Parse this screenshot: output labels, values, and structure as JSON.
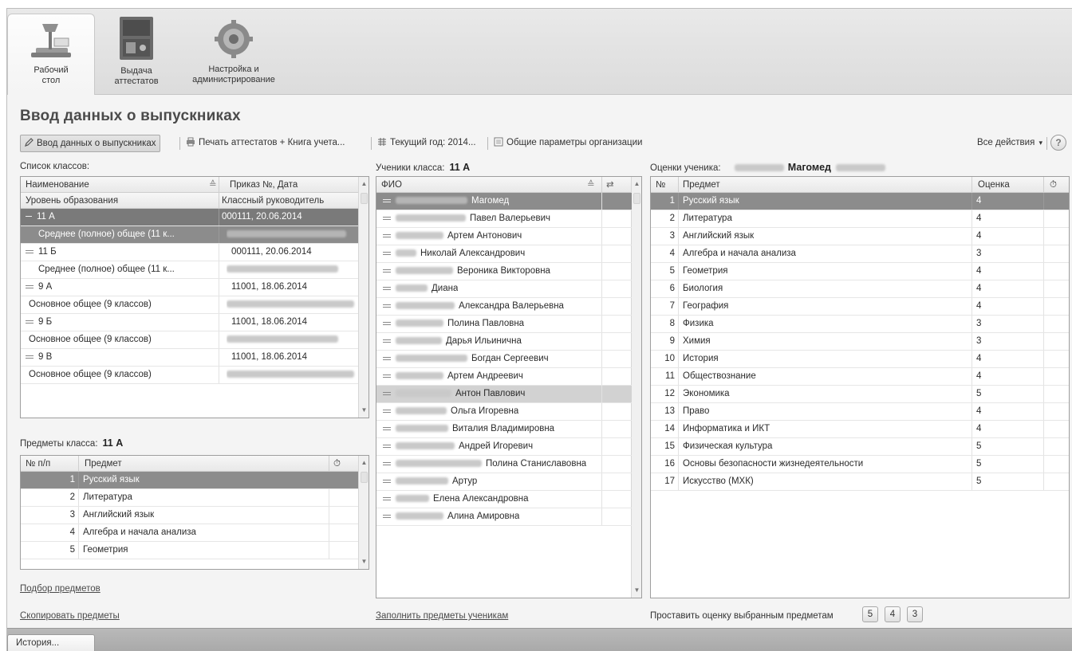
{
  "sections": [
    {
      "label1": "Рабочий",
      "label2": "стол",
      "icon": "desk-lamp-icon"
    },
    {
      "label1": "Выдача",
      "label2": "аттестатов",
      "icon": "safe-icon"
    },
    {
      "label1": "Настройка и",
      "label2": "администрирование",
      "icon": "gear-icon"
    }
  ],
  "title": "Ввод данных о выпускниках",
  "toolbar": {
    "input_data": "Ввод данных о выпускниках",
    "print": "Печать аттестатов + Книга учета...",
    "current_year": "Текущий год: 2014...",
    "org_params": "Общие параметры организации",
    "all_actions": "Все действия",
    "help": "?"
  },
  "classes": {
    "label": "Список классов:",
    "headers": [
      "Наименование",
      "Приказ №, Дата",
      "Уровень образования",
      "Классный руководитель"
    ],
    "rows": [
      {
        "name": "11 А",
        "order": "000111, 20.06.2014",
        "level": "Среднее (полное) общее (11 к..."
      },
      {
        "name": "11 Б",
        "order": "000111, 20.06.2014",
        "level": "Среднее (полное) общее (11 к..."
      },
      {
        "name": "9 А",
        "order": "11001, 18.06.2014",
        "level": "Основное общее (9 классов)"
      },
      {
        "name": "9 Б",
        "order": "11001, 18.06.2014",
        "level": "Основное общее (9 классов)"
      },
      {
        "name": "9 В",
        "order": "11001, 18.06.2014",
        "level": "Основное общее (9 классов)"
      }
    ]
  },
  "class_subjects": {
    "label": "Предметы класса:",
    "class_name": "11 А",
    "headers": [
      "№ п/п",
      "Предмет"
    ],
    "rows": [
      {
        "n": "1",
        "subject": "Русский язык"
      },
      {
        "n": "2",
        "subject": "Литература"
      },
      {
        "n": "3",
        "subject": "Английский язык"
      },
      {
        "n": "4",
        "subject": "Алгебра и начала анализа"
      },
      {
        "n": "5",
        "subject": "Геометрия"
      }
    ],
    "link_pick": "Подбор предметов",
    "link_copy": "Скопировать предметы"
  },
  "students": {
    "label": "Ученики класса:",
    "class_name": "11 А",
    "header": "ФИО",
    "rows": [
      "Магомед",
      "Павел Валерьевич",
      "Артем Антонович",
      "Николай Александрович",
      "Вероника Викторовна",
      "Диана",
      "Александра Валерьевна",
      "Полина Павловна",
      "Дарья Ильинична",
      "Богдан Сергеевич",
      "Артем Андреевич",
      "Антон Павлович",
      "Ольга Игоревна",
      "Виталия Владимировна",
      "Андрей Игоревич",
      "Полина Станиславовна",
      "Артур",
      "Елена Александровна",
      "Алина Амировна"
    ],
    "link_fill": "Заполнить предметы ученикам"
  },
  "grades": {
    "label": "Оценки ученика:",
    "student_name": "Магомед",
    "headers": [
      "№",
      "Предмет",
      "Оценка"
    ],
    "rows": [
      {
        "n": "1",
        "subject": "Русский язык",
        "grade": "4"
      },
      {
        "n": "2",
        "subject": "Литература",
        "grade": "4"
      },
      {
        "n": "3",
        "subject": "Английский язык",
        "grade": "4"
      },
      {
        "n": "4",
        "subject": "Алгебра и начала анализа",
        "grade": "3"
      },
      {
        "n": "5",
        "subject": "Геометрия",
        "grade": "4"
      },
      {
        "n": "6",
        "subject": "Биология",
        "grade": "4"
      },
      {
        "n": "7",
        "subject": "География",
        "grade": "4"
      },
      {
        "n": "8",
        "subject": "Физика",
        "grade": "3"
      },
      {
        "n": "9",
        "subject": "Химия",
        "grade": "3"
      },
      {
        "n": "10",
        "subject": "История",
        "grade": "4"
      },
      {
        "n": "11",
        "subject": "Обществознание",
        "grade": "4"
      },
      {
        "n": "12",
        "subject": "Экономика",
        "grade": "5"
      },
      {
        "n": "13",
        "subject": "Право",
        "grade": "4"
      },
      {
        "n": "14",
        "subject": "Информатика и ИКТ",
        "grade": "4"
      },
      {
        "n": "15",
        "subject": "Физическая культура",
        "grade": "5"
      },
      {
        "n": "16",
        "subject": "Основы безопасности жизнедеятельности",
        "grade": "5"
      },
      {
        "n": "17",
        "subject": "Искусство (МХК)",
        "grade": "5"
      }
    ],
    "set_label": "Проставить оценку выбранным предметам",
    "buttons": [
      "5",
      "4",
      "3"
    ]
  },
  "statusbar": {
    "history": "История..."
  }
}
